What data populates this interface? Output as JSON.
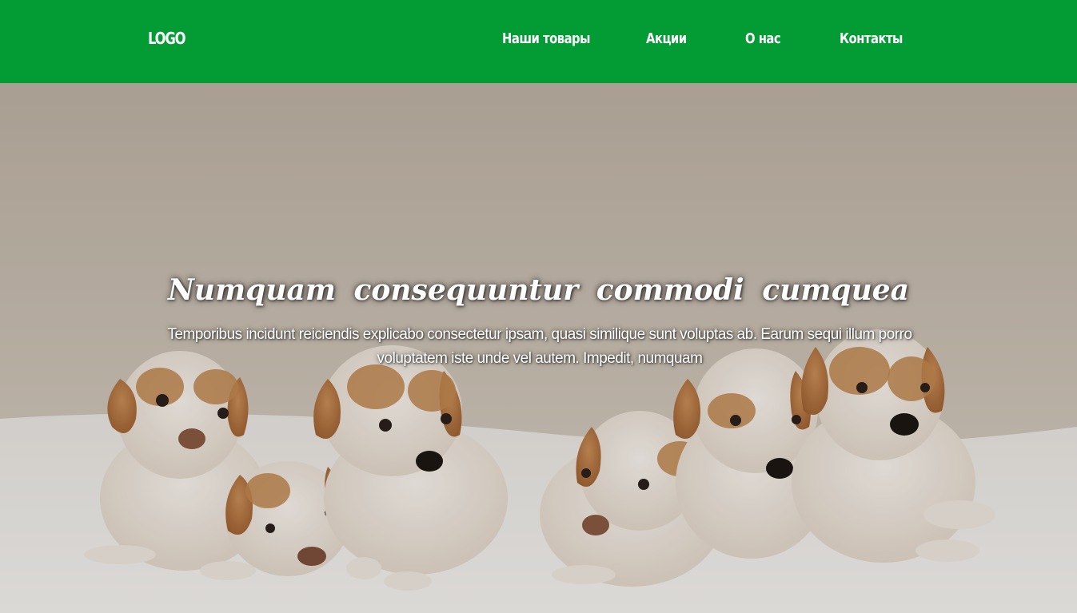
{
  "header": {
    "logo": "LOGO",
    "nav": [
      {
        "label": "Наши товары"
      },
      {
        "label": "Акции"
      },
      {
        "label": "О нас"
      },
      {
        "label": "Контакты"
      }
    ],
    "background_color": "#029b34"
  },
  "hero": {
    "title": "Numquam consequuntur commodi cumquea",
    "text": "Temporibus incidunt reiciendis explicabo consectetur ipsam, quasi similique sunt voluptas ab. Earum sequi illum porro voluptatem iste unde vel autem. Impedit, numquam",
    "image": "puppies-photo"
  }
}
